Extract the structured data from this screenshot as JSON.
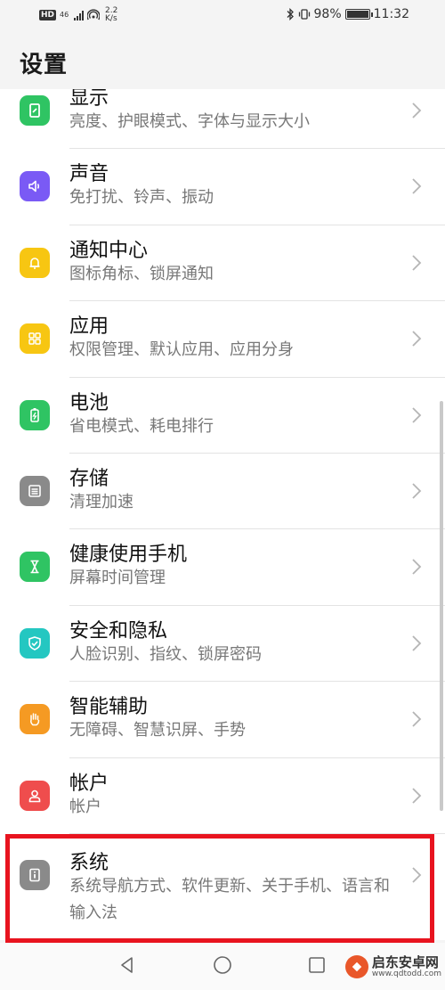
{
  "status_bar": {
    "hd": "HD",
    "network": "46",
    "speed_value": "2.2",
    "speed_unit": "K/s",
    "battery": "98%",
    "battery_level": 0.98,
    "time": "11:32"
  },
  "header": {
    "title": "设置"
  },
  "items": [
    {
      "title": "显示",
      "subtitle": "亮度、护眼模式、字体与显示大小",
      "icon": "display-icon",
      "color": "#2fc463"
    },
    {
      "title": "声音",
      "subtitle": "免打扰、铃声、振动",
      "icon": "speaker-icon",
      "color": "#7a5af5"
    },
    {
      "title": "通知中心",
      "subtitle": "图标角标、锁屏通知",
      "icon": "bell-icon",
      "color": "#f7c612"
    },
    {
      "title": "应用",
      "subtitle": "权限管理、默认应用、应用分身",
      "icon": "apps-grid-icon",
      "color": "#f7c612"
    },
    {
      "title": "电池",
      "subtitle": "省电模式、耗电排行",
      "icon": "battery-icon",
      "color": "#2fc463"
    },
    {
      "title": "存储",
      "subtitle": "清理加速",
      "icon": "storage-icon",
      "color": "#8a8a8a"
    },
    {
      "title": "健康使用手机",
      "subtitle": "屏幕时间管理",
      "icon": "hourglass-icon",
      "color": "#2fc463"
    },
    {
      "title": "安全和隐私",
      "subtitle": "人脸识别、指纹、锁屏密码",
      "icon": "shield-icon",
      "color": "#24c7c1"
    },
    {
      "title": "智能辅助",
      "subtitle": "无障碍、智慧识屏、手势",
      "icon": "hand-icon",
      "color": "#f59a23"
    },
    {
      "title": "帐户",
      "subtitle": "帐户",
      "icon": "user-icon",
      "color": "#ef4d4d"
    },
    {
      "title": "系统",
      "subtitle": "系统导航方式、软件更新、关于手机、语言和输入法",
      "icon": "info-icon",
      "color": "#8a8a8a"
    }
  ],
  "highlight_color": "#e8141f",
  "watermark": {
    "name": "启东安卓网",
    "url": "www.qdtodd.com"
  }
}
